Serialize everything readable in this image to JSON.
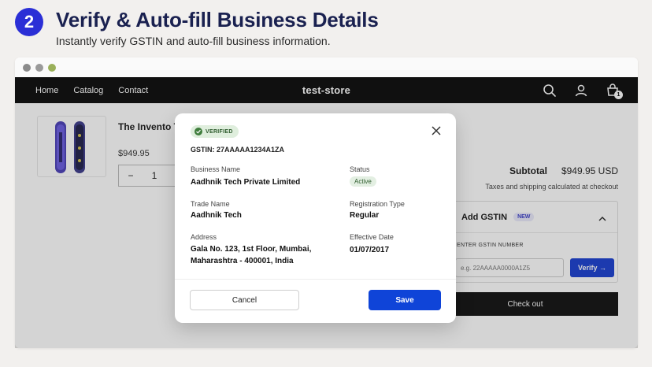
{
  "header": {
    "step_number": "2",
    "title": "Verify & Auto-fill Business Details",
    "subtitle": "Instantly verify GSTIN and auto-fill business information."
  },
  "navbar": {
    "links": [
      "Home",
      "Catalog",
      "Contact"
    ],
    "store_name": "test-store",
    "cart_count": "1"
  },
  "cart": {
    "product_title": "The Invento Tracked Sno",
    "product_price": "$949.95",
    "quantity": "1",
    "qty_minus": "−",
    "subtotal_label": "Subtotal",
    "subtotal_value": "$949.95 USD",
    "tax_note": "Taxes and shipping calculated at checkout",
    "checkout_label": "Check out"
  },
  "gstin_panel": {
    "title": "Add GSTIN",
    "new_badge": "NEW",
    "field_label": "ENTER GSTIN NUMBER",
    "input_placeholder": "e.g. 22AAAAA0000A1Z5",
    "verify_label": "Verify →"
  },
  "modal": {
    "verified_badge": "VERIFIED",
    "gstin_line": "GSTIN: 27AAAAA1234A1ZA",
    "business_name_label": "Business Name",
    "business_name": "Aadhnik Tech Private Limited",
    "status_label": "Status",
    "status_value": "Active",
    "trade_name_label": "Trade Name",
    "trade_name": "Aadhnik Tech",
    "registration_type_label": "Registration Type",
    "registration_type": "Regular",
    "address_label": "Address",
    "address_line1": "Gala No. 123, 1st Floor, Mumbai,",
    "address_line2": "Maharashtra - 400001, India",
    "effective_date_label": "Effective Date",
    "effective_date": "01/07/2017",
    "cancel_label": "Cancel",
    "save_label": "Save"
  },
  "colors": {
    "primary_blue": "#0f44d8",
    "step_badge": "#2b2fd6",
    "verified_green": "#3f7d3c",
    "navbar_bg": "#0b0b0b"
  }
}
